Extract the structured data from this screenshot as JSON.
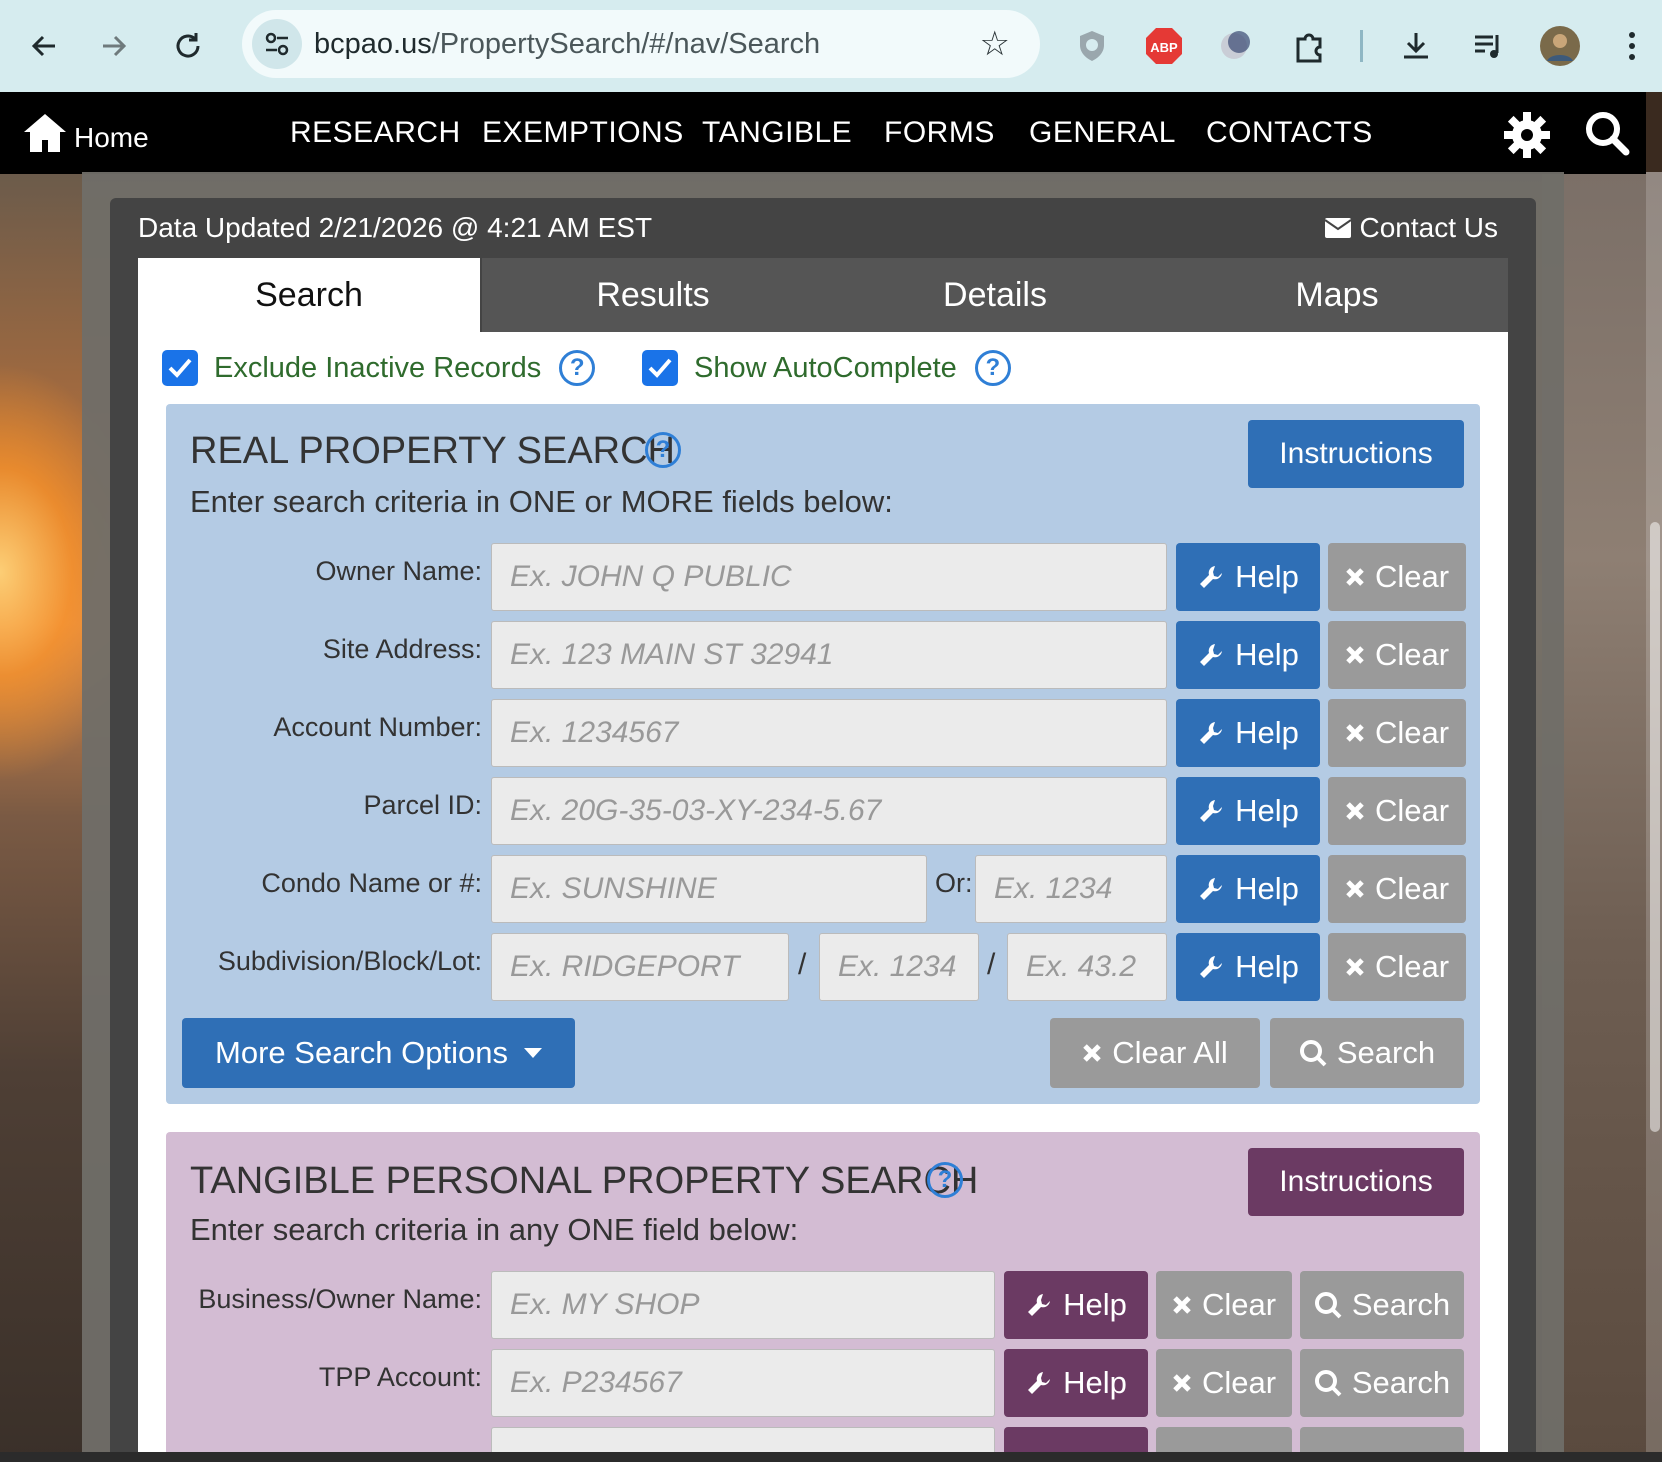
{
  "browser": {
    "url_host": "bcpao.us",
    "url_path": "/PropertySearch/#/nav/Search",
    "extension_abp": "ABP"
  },
  "nav": {
    "home": "Home",
    "items": [
      "RESEARCH",
      "EXEMPTIONS",
      "TANGIBLE",
      "FORMS",
      "GENERAL",
      "CONTACTS"
    ]
  },
  "header": {
    "data_updated": "Data Updated 2/21/2026 @ 4:21 AM EST",
    "contact_us": "Contact Us"
  },
  "tabs": [
    "Search",
    "Results",
    "Details",
    "Maps"
  ],
  "active_tab": "Search",
  "options": {
    "exclude_inactive": {
      "label": "Exclude Inactive Records",
      "checked": true
    },
    "show_autocomplete": {
      "label": "Show AutoComplete",
      "checked": true
    },
    "help_mark": "?"
  },
  "real_property": {
    "title": "REAL PROPERTY SEARCH",
    "subtitle": "Enter search criteria in ONE or MORE fields below:",
    "instructions": "Instructions",
    "rows": [
      {
        "label": "Owner Name:",
        "placeholder": "Ex. JOHN Q PUBLIC"
      },
      {
        "label": "Site Address:",
        "placeholder": "Ex. 123 MAIN ST 32941"
      },
      {
        "label": "Account Number:",
        "placeholder": "Ex. 1234567"
      },
      {
        "label": "Parcel ID:",
        "placeholder": "Ex. 20G-35-03-XY-234-5.67"
      }
    ],
    "condo": {
      "label": "Condo Name or #:",
      "placeholder_name": "Ex. SUNSHINE",
      "or_label": "Or:",
      "placeholder_num": "Ex. 1234"
    },
    "subdivision": {
      "label": "Subdivision/Block/Lot:",
      "placeholder_sub": "Ex. RIDGEPORT",
      "placeholder_block": "Ex. 1234",
      "placeholder_lot": "Ex. 43.2",
      "separator": "/"
    },
    "help_label": "Help",
    "clear_label": "Clear",
    "more_options": "More Search Options",
    "clear_all": "Clear All",
    "search": "Search"
  },
  "tangible": {
    "title": "TANGIBLE PERSONAL PROPERTY SEARCH",
    "subtitle": "Enter search criteria in any ONE field below:",
    "instructions": "Instructions",
    "rows": [
      {
        "label": "Business/Owner Name:",
        "placeholder": "Ex. MY SHOP"
      },
      {
        "label": "TPP Account:",
        "placeholder": "Ex. P234567"
      }
    ],
    "help_label": "Help",
    "clear_label": "Clear",
    "search_label": "Search"
  },
  "colors": {
    "real_box": "#b4cbe4",
    "tpp_box": "#d3bcd3",
    "primary_blue": "#2f6fb6",
    "tpp_purple": "#6b3a63",
    "check_green": "#2f6b2d"
  }
}
